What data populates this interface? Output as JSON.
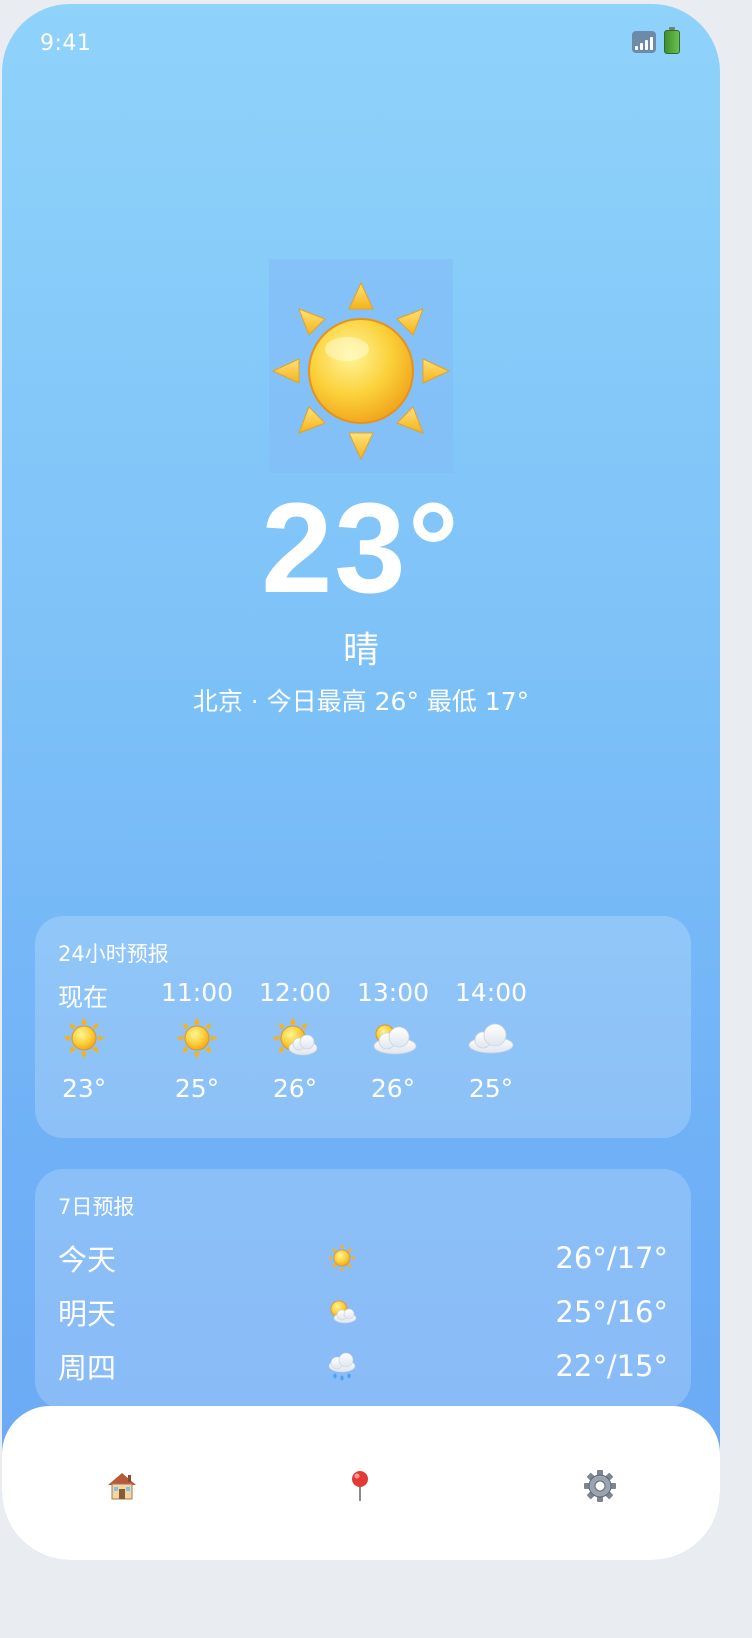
{
  "status_bar": {
    "time": "9:41",
    "icons": [
      "signal-icon",
      "battery-icon"
    ]
  },
  "current": {
    "icon": "sun-icon",
    "temperature": "23°",
    "condition": "晴",
    "summary": "北京 · 今日最高 26° 最低 17°"
  },
  "hourly": {
    "title": "24小时预报",
    "items": [
      {
        "time": "现在",
        "icon": "sun-icon",
        "temp": "23°"
      },
      {
        "time": "11:00",
        "icon": "sun-icon",
        "temp": "25°"
      },
      {
        "time": "12:00",
        "icon": "sun-behind-small-cloud-icon",
        "temp": "26°"
      },
      {
        "time": "13:00",
        "icon": "sun-behind-cloud-icon",
        "temp": "26°"
      },
      {
        "time": "14:00",
        "icon": "cloud-icon",
        "temp": "25°"
      }
    ]
  },
  "daily": {
    "title": "7日预报",
    "items": [
      {
        "day": "今天",
        "icon": "sun-icon",
        "range": "26°/17°"
      },
      {
        "day": "明天",
        "icon": "sun-behind-cloud-icon",
        "range": "25°/16°"
      },
      {
        "day": "周四",
        "icon": "rain-cloud-icon",
        "range": "22°/15°"
      }
    ]
  },
  "tabbar": {
    "items": [
      {
        "icon": "house-icon"
      },
      {
        "icon": "location-pin-icon"
      },
      {
        "icon": "gear-icon"
      }
    ]
  },
  "colors": {
    "sky_top": "#8fd3fb",
    "sky_bottom": "#6aa8f4",
    "text": "#ffffff",
    "sun": "#f7c52c"
  }
}
